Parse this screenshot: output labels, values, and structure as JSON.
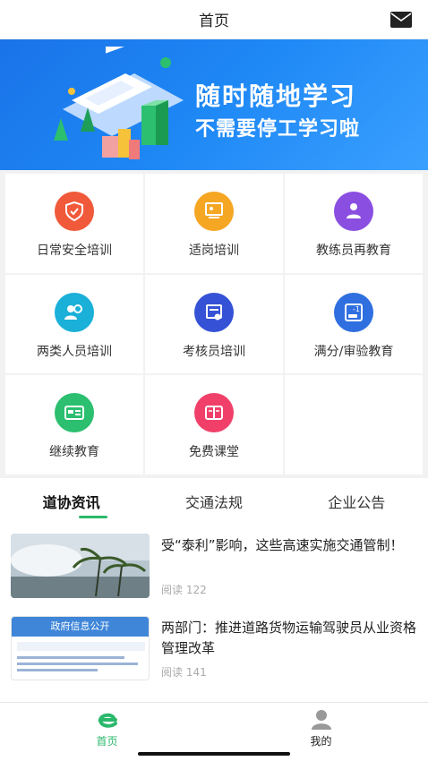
{
  "header": {
    "title": "首页",
    "mail_icon": "mail-icon"
  },
  "banner": {
    "line1": "随时随地学习",
    "line2": "不需要停工学习啦"
  },
  "categories": [
    {
      "label": "日常安全培训",
      "icon": "shield-icon",
      "color": "#f05a3a"
    },
    {
      "label": "适岗培训",
      "icon": "presenter-icon",
      "color": "#f5a623"
    },
    {
      "label": "教练员再教育",
      "icon": "instructor-icon",
      "color": "#8a4fe0"
    },
    {
      "label": "两类人员培训",
      "icon": "people-icon",
      "color": "#1ab0d8"
    },
    {
      "label": "考核员培训",
      "icon": "certificate-icon",
      "color": "#3552d6"
    },
    {
      "label": "满分/审验教育",
      "icon": "car-deduct-icon",
      "color": "#2f6fe0"
    },
    {
      "label": "继续教育",
      "icon": "id-card-icon",
      "color": "#2bbf6f"
    },
    {
      "label": "免费课堂",
      "icon": "book-icon",
      "color": "#f0406a"
    }
  ],
  "tabs": [
    {
      "label": "道协资讯",
      "active": true
    },
    {
      "label": "交通法规",
      "active": false
    },
    {
      "label": "企业公告",
      "active": false
    }
  ],
  "news": [
    {
      "title": "受“泰利”影响，这些高速实施交通管制！",
      "reads": "阅读 122"
    },
    {
      "title": "两部门：推进道路货物运输驾驶员从业资格管理改革",
      "reads": "阅读 141",
      "thumb_heading": "政府信息公开"
    }
  ],
  "bottom_nav": [
    {
      "label": "首页",
      "active": true,
      "icon": "home-e-icon"
    },
    {
      "label": "我的",
      "active": false,
      "icon": "profile-icon"
    }
  ],
  "colors": {
    "accent": "#2ab86b",
    "banner": "#1a73e8"
  }
}
